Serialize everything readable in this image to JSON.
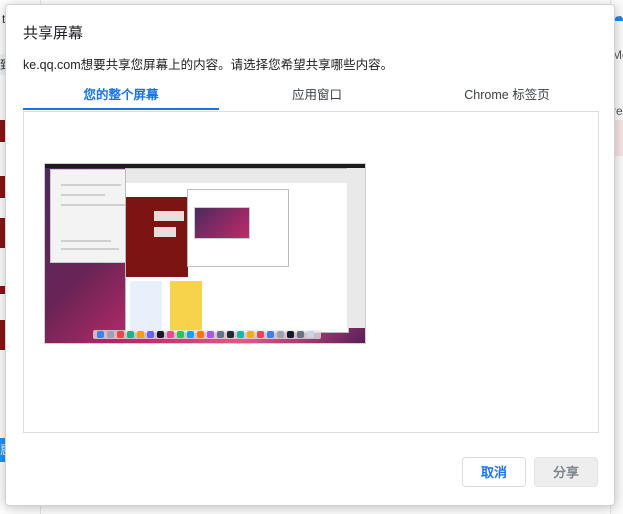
{
  "background": {
    "left_fragments": [
      "t",
      "致",
      "惠"
    ],
    "right_fragments": [
      "Me",
      "re"
    ]
  },
  "dialog": {
    "title": "共享屏幕",
    "description": "ke.qq.com想要共享您屏幕上的内容。请选择您希望共享哪些内容。",
    "tabs": [
      {
        "label": "您的整个屏幕",
        "active": true
      },
      {
        "label": "应用窗口",
        "active": false
      },
      {
        "label": "Chrome 标签页",
        "active": false
      }
    ],
    "buttons": {
      "cancel": "取消",
      "share": "分享"
    }
  },
  "colors": {
    "accent": "#1a73e8",
    "share_disabled_bg": "#eeeeee",
    "share_disabled_text": "#80868b"
  },
  "thumbnail": {
    "icon": "screen-thumbnail",
    "desktop_wallpaper": [
      "#4b2a5e",
      "#c12a6a",
      "#e15b86"
    ]
  }
}
